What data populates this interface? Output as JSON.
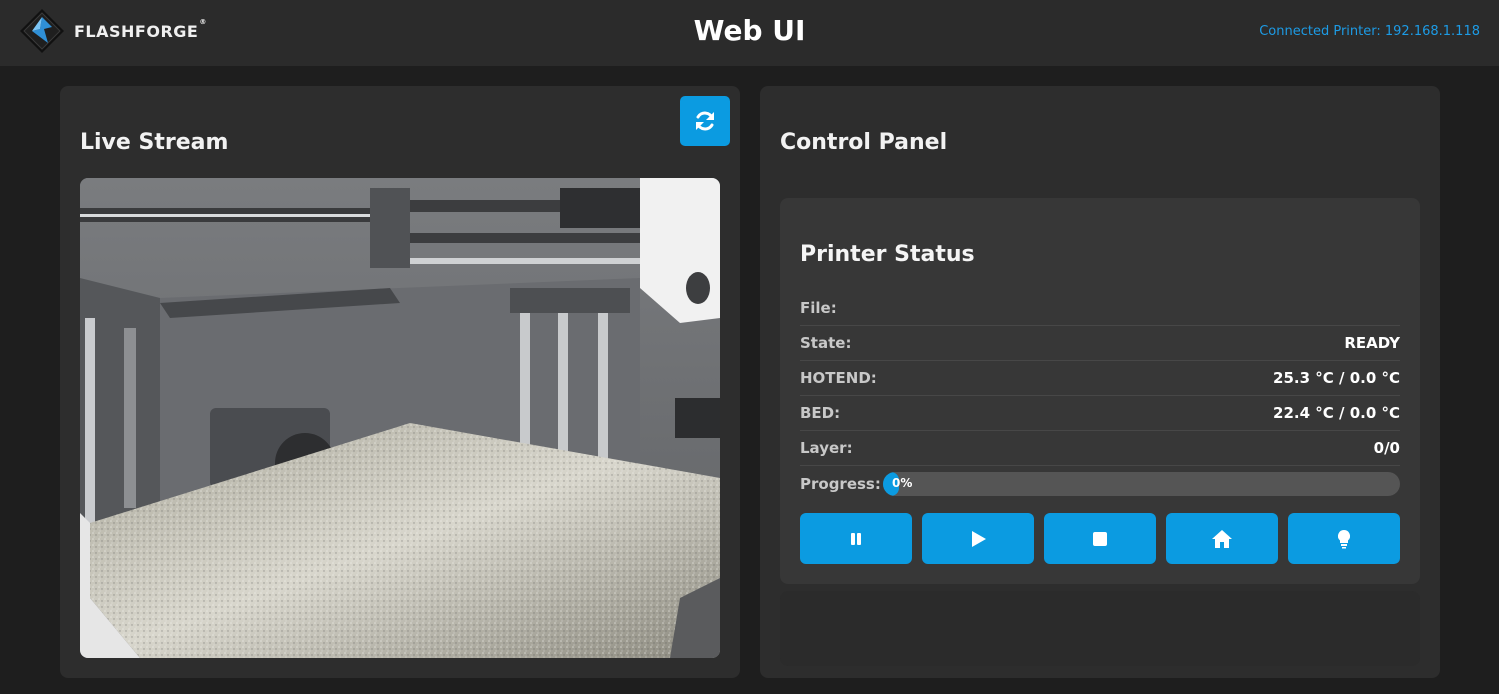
{
  "header": {
    "brand": "FLASHFORGE",
    "brand_mark": "®",
    "title": "Web UI",
    "connection": "Connected Printer: 192.168.1.118"
  },
  "live_stream": {
    "title": "Live Stream",
    "refresh_icon": "refresh-icon"
  },
  "control_panel": {
    "title": "Control Panel",
    "status": {
      "title": "Printer Status",
      "rows": [
        {
          "label": "File:",
          "value": ""
        },
        {
          "label": "State:",
          "value": "READY"
        },
        {
          "label": "HOTEND:",
          "value": "25.3 °C / 0.0 °C"
        },
        {
          "label": "BED:",
          "value": "22.4 °C / 0.0 °C"
        },
        {
          "label": "Layer:",
          "value": "0/0"
        }
      ],
      "progress_label": "Progress:",
      "progress_text": "0%",
      "progress_value": 0
    },
    "buttons": [
      {
        "icon": "pause-icon"
      },
      {
        "icon": "play-icon"
      },
      {
        "icon": "stop-icon"
      },
      {
        "icon": "home-icon"
      },
      {
        "icon": "lightbulb-icon"
      }
    ]
  },
  "colors": {
    "accent": "#0b9be1",
    "link": "#1d9be5",
    "background": "#1e1e1e",
    "panel": "#2d2d2d",
    "card": "#373737"
  }
}
